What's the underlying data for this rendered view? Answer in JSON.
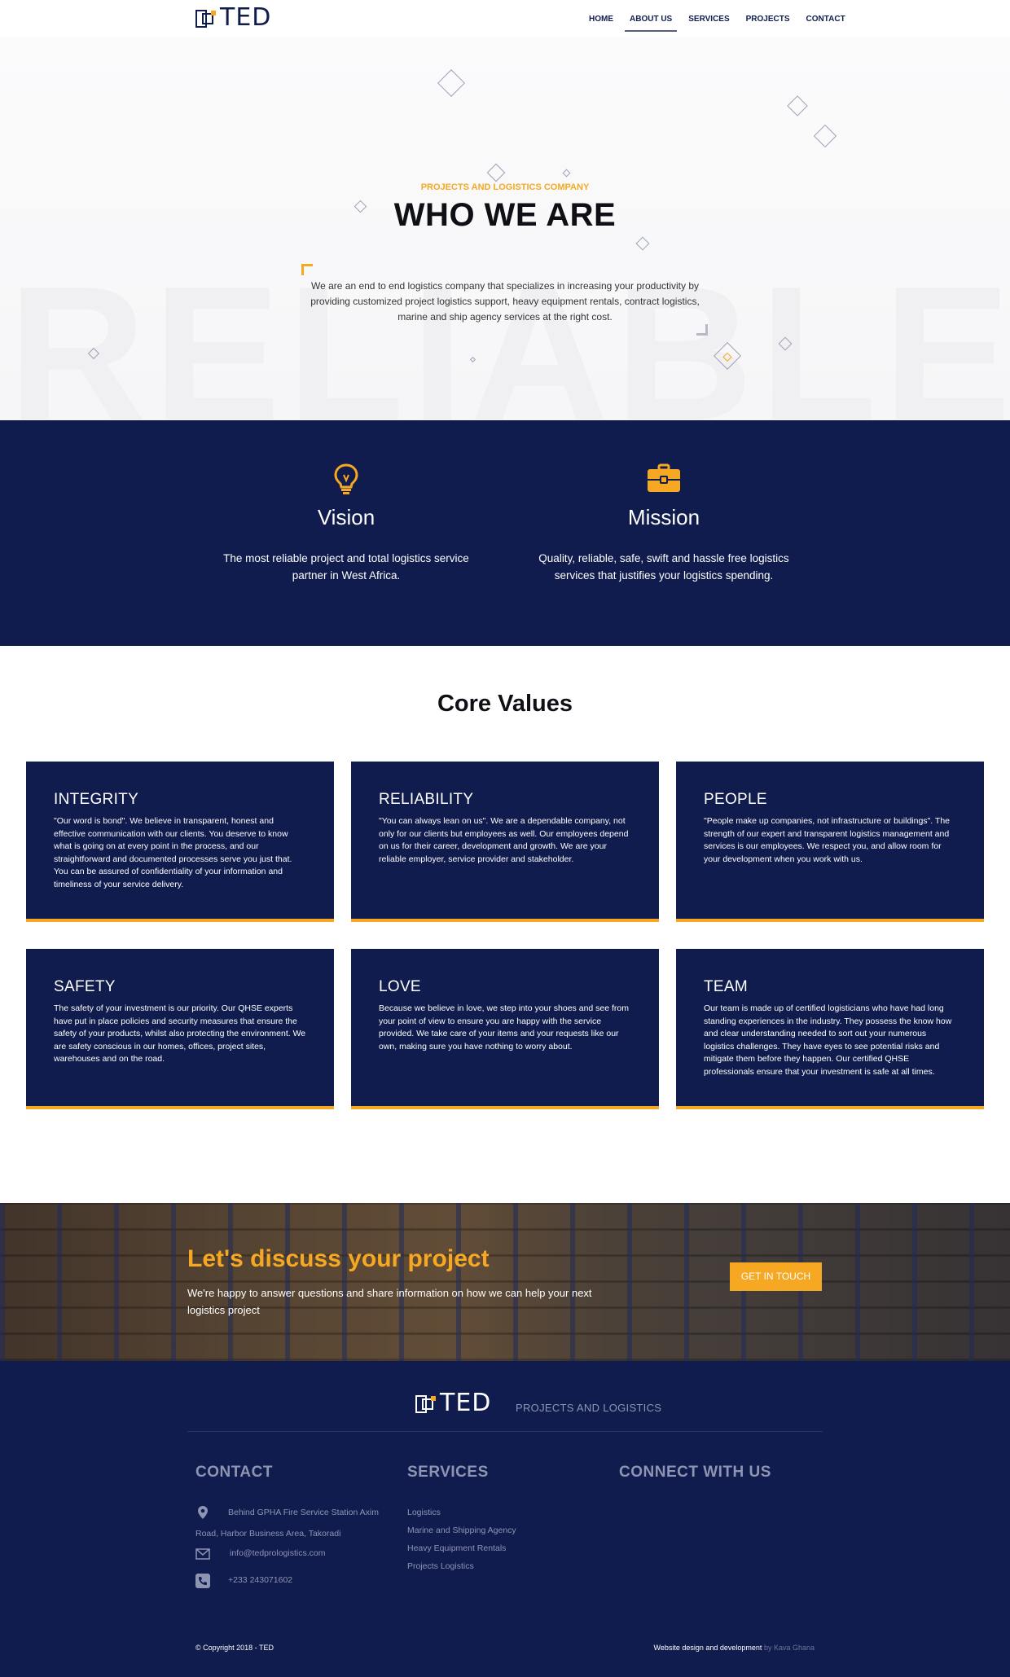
{
  "brand": {
    "name": "TED",
    "tagline": "PROJECTS AND LOGISTICS"
  },
  "nav": {
    "items": [
      "HOME",
      "ABOUT US",
      "SERVICES",
      "PROJECTS",
      "CONTACT"
    ],
    "active": "ABOUT US"
  },
  "hero": {
    "kicker": "PROJECTS AND LOGISTICS COMPANY",
    "title": "WHO WE ARE",
    "text": "We are an end to end logistics company that specializes in increasing your productivity by providing customized project logistics support, heavy equipment rentals, contract logistics, marine and ship agency services at the right cost.",
    "watermark": "RELIABLE"
  },
  "vision": {
    "icon": "lightbulb-icon",
    "title": "Vision",
    "text": "The most reliable project and total logistics service partner in West Africa."
  },
  "mission": {
    "icon": "briefcase-icon",
    "title": "Mission",
    "text": "Quality, reliable, safe, swift and hassle free logistics services that justifies your logistics spending."
  },
  "core_values": {
    "title": "Core Values",
    "cards": [
      {
        "title": "INTEGRITY",
        "text": "\"Our word is bond\". We believe in transparent, honest and effective communication with our clients. You deserve to know what is going on at every point in the process, and our straightforward and documented processes serve you just that. You can be assured of confidentiality of your information and timeliness of your service delivery."
      },
      {
        "title": "RELIABILITY",
        "text": "\"You can always lean on us\". We are a dependable company, not only for our clients but employees as well. Our employees depend on us for their career, development and growth. We are your reliable employer, service provider and stakeholder."
      },
      {
        "title": "PEOPLE",
        "text": "\"People make up companies, not infrastructure or buildings\". The strength of our expert and transparent logistics management and services is our employees. We respect you, and allow room for your development when you work with us."
      },
      {
        "title": "SAFETY",
        "text": "The safety of your investment is our priority. Our QHSE experts have put in place policies and security measures that ensure the safety of your products, whilst also protecting the environment. We are safety conscious in our homes, offices, project sites, warehouses and on the road."
      },
      {
        "title": "LOVE",
        "text": "Because we believe in love, we step into your shoes and see from your point of view to ensure you are happy with the service provided. We take care of your items and your requests like our own, making sure you have nothing to worry about."
      },
      {
        "title": "TEAM",
        "text": "Our team is made up of certified logisticians who have had long standing experiences in the industry. They possess the know how and clear understanding needed to sort out your numerous logistics challenges. They have eyes to see potential risks and mitigate them before they happen. Our certified QHSE professionals ensure that your investment is safe at all times."
      }
    ]
  },
  "cta": {
    "title": "Let's discuss your project",
    "text": "We're happy to answer questions and share information on how we can help your next logistics project",
    "button": "GET IN TOUCH"
  },
  "footer": {
    "tagline": "PROJECTS AND LOGISTICS",
    "contact_heading": "CONTACT",
    "address_line1": "Behind GPHA Fire Service Station Axim",
    "address_line2": "Road, Harbor Business Area, Takoradi",
    "email": "info@tedprologistics.com",
    "phone": "+233 243071602",
    "services_heading": "SERVICES",
    "services": [
      "Logistics",
      "Marine and Shipping Agency",
      "Heavy Equipment Rentals",
      "Projects Logistics"
    ],
    "connect_heading": "CONNECT WITH US",
    "copyright": "© Copyright 2018 - TED",
    "credit_prefix": "Website design and development",
    "credit_by": "by Kava Ghana"
  },
  "colors": {
    "navy": "#101c4d",
    "gold": "#f6a823"
  }
}
